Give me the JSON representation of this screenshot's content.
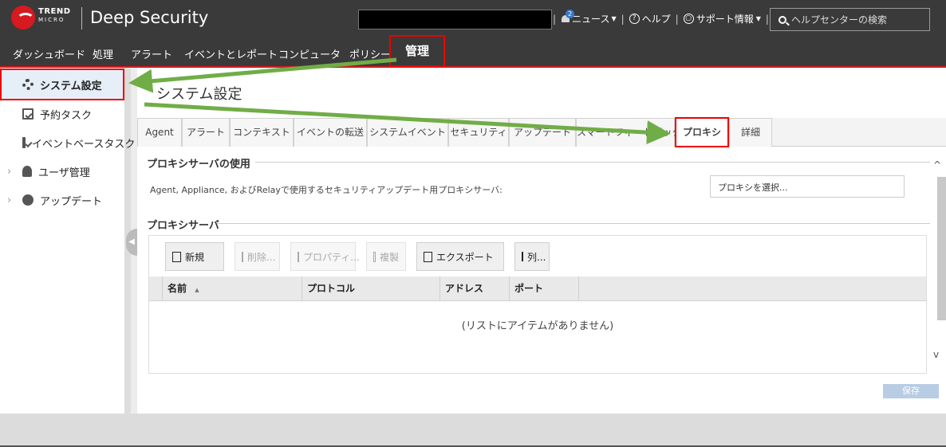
{
  "header": {
    "brand_line1": "TREND",
    "brand_line2": "MICRO",
    "product": "Deep Security",
    "news_badge": "2",
    "news": "ニュース",
    "help": "ヘルプ",
    "support": "サポート情報",
    "search_placeholder": "ヘルプセンターの検索"
  },
  "nav": {
    "items": [
      "ダッシュボード",
      "処理",
      "アラート",
      "イベントとレポート",
      "コンピュータ",
      "ポリシー",
      "管理"
    ],
    "active": "管理"
  },
  "sidebar": {
    "items": [
      {
        "label": "システム設定",
        "icon": "gear-icon",
        "selected": true
      },
      {
        "label": "予約タスク",
        "icon": "task-icon"
      },
      {
        "label": "イベントベースタスク",
        "icon": "task-icon"
      },
      {
        "label": "ユーザ管理",
        "icon": "users-icon",
        "expandable": true
      },
      {
        "label": "アップデート",
        "icon": "update-icon",
        "expandable": true
      }
    ]
  },
  "main": {
    "title": "システム設定",
    "tabs": [
      "Agent",
      "アラート",
      "コンテキスト",
      "イベントの転送",
      "システムイベント",
      "セキュリティ",
      "アップデート",
      "スマートフィードバック",
      "プロキシ",
      "詳細"
    ],
    "active_tab": "プロキシ",
    "section1_title": "プロキシサーバの使用",
    "proxy_desc": "Agent, Appliance, およびRelayで使用するセキュリティアップデート用プロキシサーバ:",
    "proxy_select_value": "プロキシを選択...",
    "section2_title": "プロキシサーバ",
    "toolbar": {
      "new": "新規",
      "delete": "削除...",
      "properties": "プロパティ...",
      "duplicate": "複製",
      "export": "エクスポート",
      "columns": "列..."
    },
    "columns": [
      "名前",
      "プロトコル",
      "アドレス",
      "ポート"
    ],
    "sort_indicator": "▲",
    "empty_message": "(リストにアイテムがありません)",
    "save": "保存"
  },
  "colors": {
    "header_bg": "#3a3a3a",
    "highlight_red": "#e00000",
    "arrow_green": "#70ad47",
    "save_button": "#b8cce4"
  }
}
